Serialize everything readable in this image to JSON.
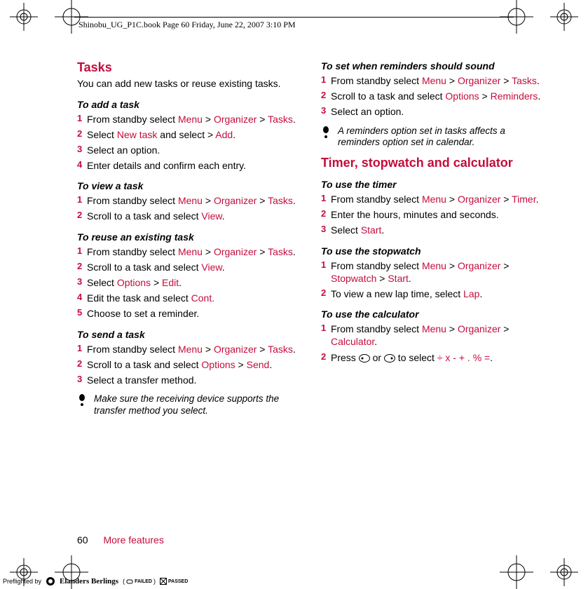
{
  "header": {
    "text": "Shinobu_UG_P1C.book  Page 60  Friday, June 22, 2007  3:10 PM"
  },
  "left": {
    "tasks_title": "Tasks",
    "tasks_intro": "You can add new tasks or reuse existing tasks.",
    "add_task_title": "To add a task",
    "add_task_steps": [
      {
        "n": "1",
        "pre": "From standby select ",
        "m1": "Menu",
        "s1": " > ",
        "m2": "Organizer",
        "s2": " > ",
        "m3": "Tasks",
        "post": "."
      },
      {
        "n": "2",
        "pre": "Select ",
        "m1": "New task",
        "s1": " and select > ",
        "m2": "Add",
        "post": "."
      },
      {
        "n": "3",
        "pre": "Select an option."
      },
      {
        "n": "4",
        "pre": "Enter details and confirm each entry."
      }
    ],
    "view_task_title": "To view a task",
    "view_task_steps": [
      {
        "n": "1",
        "pre": "From standby select ",
        "m1": "Menu",
        "s1": " > ",
        "m2": "Organizer",
        "s2": " > ",
        "m3": "Tasks",
        "post": "."
      },
      {
        "n": "2",
        "pre": "Scroll to a task and select ",
        "m1": "View",
        "post": "."
      }
    ],
    "reuse_title": "To reuse an existing task",
    "reuse_steps": [
      {
        "n": "1",
        "pre": "From standby select ",
        "m1": "Menu",
        "s1": " > ",
        "m2": "Organizer",
        "s2": " > ",
        "m3": "Tasks",
        "post": "."
      },
      {
        "n": "2",
        "pre": "Scroll to a task and select ",
        "m1": "View",
        "post": "."
      },
      {
        "n": "3",
        "pre": "Select ",
        "m1": "Options",
        "s1": " > ",
        "m2": "Edit",
        "post": "."
      },
      {
        "n": "4",
        "pre": "Edit the task and select ",
        "m1": "Cont.",
        "post": ""
      },
      {
        "n": "5",
        "pre": "Choose to set a reminder."
      }
    ],
    "send_title": "To send a task",
    "send_steps": [
      {
        "n": "1",
        "pre": "From standby select ",
        "m1": "Menu",
        "s1": " > ",
        "m2": "Organizer",
        "s2": " > ",
        "m3": "Tasks",
        "post": "."
      },
      {
        "n": "2",
        "pre": "Scroll to a task and select ",
        "m1": "Options",
        "s1": " > ",
        "m2": "Send",
        "post": "."
      },
      {
        "n": "3",
        "pre": "Select a transfer method."
      }
    ],
    "note1": "Make sure the receiving device supports the transfer method you select."
  },
  "right": {
    "rem_title": "To set when reminders should sound",
    "rem_steps": [
      {
        "n": "1",
        "pre": "From standby select ",
        "m1": "Menu",
        "s1": " > ",
        "m2": "Organizer",
        "s2": " > ",
        "m3": "Tasks",
        "post": "."
      },
      {
        "n": "2",
        "pre": "Scroll to a task and select ",
        "m1": "Options",
        "s1": " > ",
        "m2": "Reminders",
        "post": "."
      },
      {
        "n": "3",
        "pre": "Select an option."
      }
    ],
    "note2": "A reminders option set in tasks affects a reminders option set in calendar.",
    "timer_title": "Timer, stopwatch and calculator",
    "use_timer_title": "To use the timer",
    "use_timer_steps": [
      {
        "n": "1",
        "pre": "From standby select ",
        "m1": "Menu",
        "s1": " > ",
        "m2": "Organizer",
        "s2": " > ",
        "m3": "Timer",
        "post": "."
      },
      {
        "n": "2",
        "pre": "Enter the hours, minutes and seconds."
      },
      {
        "n": "3",
        "pre": "Select ",
        "m1": "Start",
        "post": "."
      }
    ],
    "use_sw_title": "To use the stopwatch",
    "use_sw_steps": [
      {
        "n": "1",
        "pre": "From standby select ",
        "m1": "Menu",
        "s1": " > ",
        "m2": "Organizer",
        "s2": " > ",
        "m3": "Stopwatch",
        "s3": " > ",
        "m4": "Start",
        "post": "."
      },
      {
        "n": "2",
        "pre": "To view a new lap time, select ",
        "m1": "Lap",
        "post": "."
      }
    ],
    "use_calc_title": "To use the calculator",
    "use_calc_steps": [
      {
        "n": "1",
        "pre": "From standby select ",
        "m1": "Menu",
        "s1": " > ",
        "m2": "Organizer",
        "s2": " > ",
        "m3": "Calculator",
        "post": "."
      },
      {
        "n": "2",
        "pre": "Press ",
        "key1": "left",
        "mid": " or ",
        "key2": "right",
        "mid2": " to select ",
        "m1": "÷ x - + . % =",
        "post": "."
      }
    ]
  },
  "footer": {
    "page": "60",
    "title": "More features"
  },
  "preflight": {
    "label": "Preflighted by",
    "brand": "Elanders Berlings",
    "failed": "FAILED",
    "passed": "PASSED"
  }
}
